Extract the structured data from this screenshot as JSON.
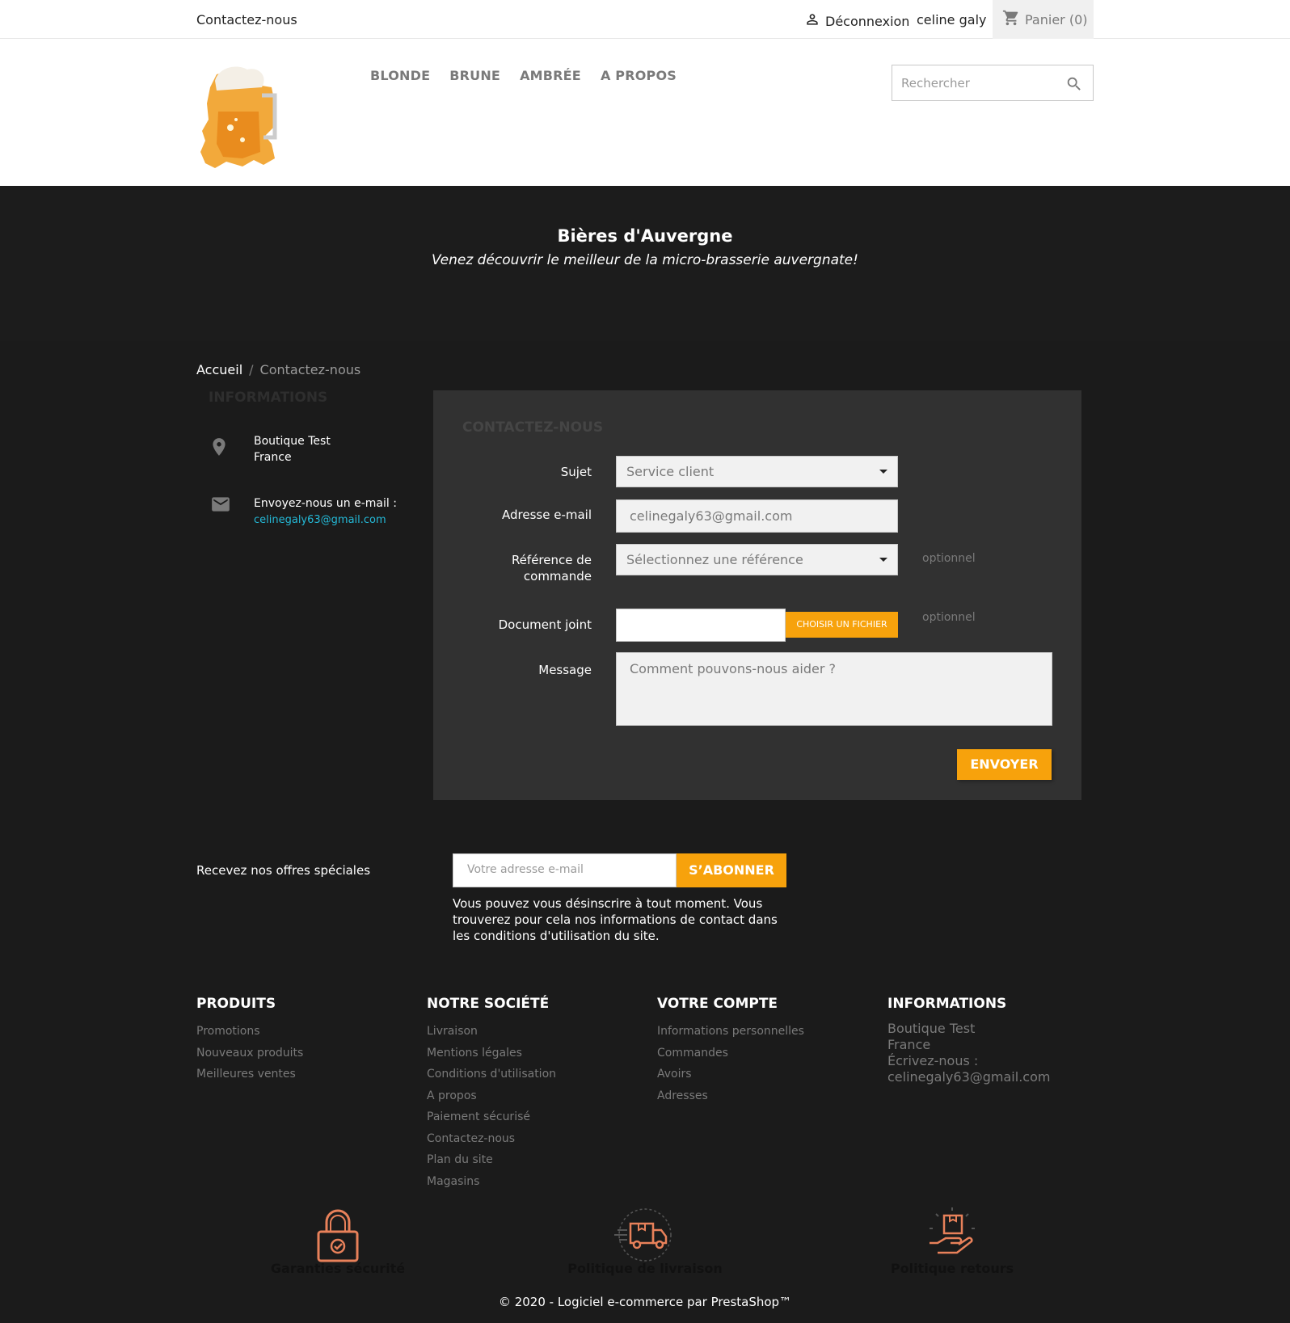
{
  "topbar": {
    "contact": "Contactez-nous",
    "logout": "Déconnexion",
    "username": "celine galy",
    "cart": "Panier (0)"
  },
  "nav": {
    "items": [
      "BLONDE",
      "BRUNE",
      "AMBRÉE",
      "A PROPOS"
    ]
  },
  "search": {
    "placeholder": "Rechercher"
  },
  "banner": {
    "title": "Bières d'Auvergne",
    "subtitle": "Venez découvrir le meilleur de la micro-brasserie auvergnate!"
  },
  "breadcrumb": {
    "home": "Accueil",
    "separator": "/",
    "current": "Contactez-nous"
  },
  "store_info": {
    "title": "INFORMATIONS",
    "name": "Boutique Test",
    "country": "France",
    "email_label": "Envoyez-nous un e-mail :",
    "email": "celinegaly63@gmail.com"
  },
  "contact_form": {
    "title": "CONTACTEZ-NOUS",
    "subject_label": "Sujet",
    "subject_value": "Service client",
    "email_label": "Adresse e-mail",
    "email_value": "celinegaly63@gmail.com",
    "order_label_1": "Référence de",
    "order_label_2": "commande",
    "order_value": "Sélectionnez une référence",
    "optional": "optionnel",
    "file_label": "Document joint",
    "file_button": "CHOISIR UN FICHIER",
    "message_label": "Message",
    "message_placeholder": "Comment pouvons-nous aider ?",
    "send": "ENVOYER"
  },
  "newsletter": {
    "label": "Recevez nos offres spéciales",
    "placeholder": "Votre adresse e-mail",
    "button": "S’ABONNER",
    "note": "Vous pouvez vous désinscrire à tout moment. Vous trouverez pour cela nos informations de contact dans les conditions d'utilisation du site."
  },
  "footer": {
    "products": {
      "title": "PRODUITS",
      "links": [
        "Promotions",
        "Nouveaux produits",
        "Meilleures ventes"
      ]
    },
    "company": {
      "title": "NOTRE SOCIÉTÉ",
      "links": [
        "Livraison",
        "Mentions légales",
        "Conditions d'utilisation",
        "A propos",
        "Paiement sécurisé",
        "Contactez-nous",
        "Plan du site",
        "Magasins"
      ]
    },
    "account": {
      "title": "VOTRE COMPTE",
      "links": [
        "Informations personnelles",
        "Commandes",
        "Avoirs",
        "Adresses"
      ]
    },
    "info": {
      "title": "INFORMATIONS",
      "line1": "Boutique Test",
      "line2": "France",
      "line3": "Écrivez-nous :",
      "line4": "celinegaly63@gmail.com"
    }
  },
  "reassurance": {
    "security": "Garanties sécurité",
    "delivery": "Politique de livraison",
    "returns": "Politique retours"
  },
  "copyright": "© 2020 - Logiciel e-commerce par PrestaShop™",
  "colors": {
    "accent": "#f7a20c",
    "link": "#24b9d7",
    "icon": "#e8815a"
  },
  "icons": [
    "person-icon",
    "cart-icon",
    "search-icon",
    "location-pin-icon",
    "mail-icon",
    "lock-icon",
    "truck-icon",
    "hand-box-icon"
  ]
}
